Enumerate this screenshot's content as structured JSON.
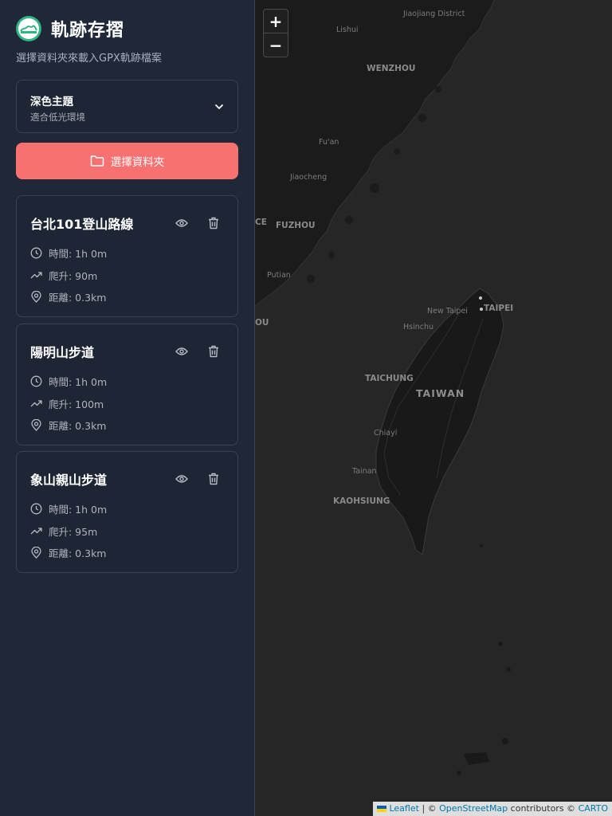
{
  "app": {
    "title": "軌跡存摺",
    "subtitle": "選擇資料夾來載入GPX軌跡檔案",
    "accent_color": "#f87171",
    "logo_color": "#2fb57f"
  },
  "theme_selector": {
    "name": "深色主題",
    "description": "適合低光環境"
  },
  "folder_button": {
    "label": "選擇資料夾",
    "icon": "folder-icon"
  },
  "tracks": [
    {
      "title": "台北101登山路線",
      "time": "時間: 1h 0m",
      "elevation": "爬升: 90m",
      "distance": "距離: 0.3km"
    },
    {
      "title": "陽明山步道",
      "time": "時間: 1h 0m",
      "elevation": "爬升: 100m",
      "distance": "距離: 0.3km"
    },
    {
      "title": "象山親山步道",
      "time": "時間: 1h 0m",
      "elevation": "爬升: 95m",
      "distance": "距離: 0.3km"
    }
  ],
  "map": {
    "zoom_in": "+",
    "zoom_out": "−",
    "labels": {
      "jiaojiang": "Jiaojiang District",
      "lishui": "Lishui",
      "wenzhou": "WENZHOU",
      "fuan": "Fu'an",
      "jiaocheng": "Jiaocheng",
      "ce": "CE",
      "fuzhou": "FUZHOU",
      "putian": "Putian",
      "ou": "OU",
      "new_taipei": "New Taipei",
      "taipei": "TAIPEI",
      "hsinchu": "Hsinchu",
      "taichung": "TAICHUNG",
      "taiwan": "TAIWAN",
      "chiayi": "Chiayi",
      "tainan": "Tainan",
      "kaohsiung": "KAOHSIUNG"
    },
    "attribution": {
      "leaflet": "Leaflet",
      "separator": "| ©",
      "osm": "OpenStreetMap",
      "contributors": "contributors ©",
      "carto": "CARTO"
    }
  }
}
